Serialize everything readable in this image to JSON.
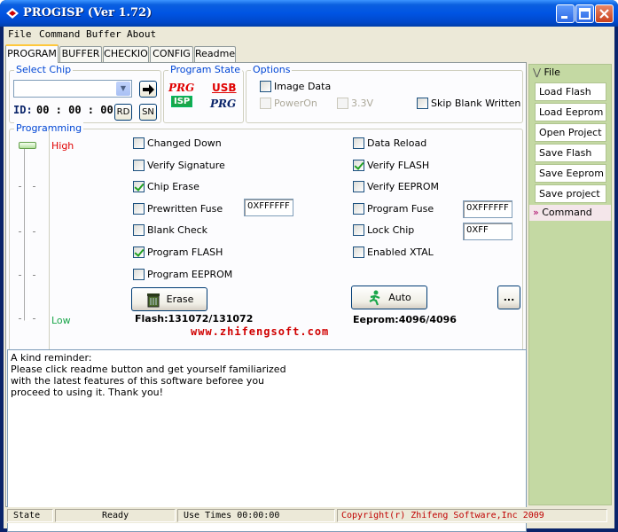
{
  "window": {
    "title": "PROGISP (Ver 1.72)"
  },
  "menu": [
    "File",
    "Command",
    "Buffer",
    "About"
  ],
  "tabs": [
    "PROGRAM",
    "BUFFER",
    "CHECKIO",
    "CONFIG",
    "Readme"
  ],
  "select_chip": {
    "label": "Select Chip",
    "value": "",
    "id_label": "ID:",
    "id_value": "00 : 00 : 00",
    "rd_label": "RD",
    "sn_label": "SN"
  },
  "program_state": {
    "label": "Program State",
    "logo1_top": "PRG",
    "logo1_bottom": "ISP",
    "logo2_top": "USB",
    "logo2_bottom": "PRG"
  },
  "options": {
    "label": "Options",
    "image_data": "Image Data",
    "power_on": "PowerOn",
    "v33": "3.3V",
    "skip_blank": "Skip Blank Written"
  },
  "programming": {
    "label": "Programming",
    "high": "High",
    "low": "Low",
    "left_options": [
      {
        "label": "Changed Down",
        "checked": false
      },
      {
        "label": "Verify Signature",
        "checked": false
      },
      {
        "label": "Chip Erase",
        "checked": true
      },
      {
        "label": "Prewritten Fuse",
        "checked": false
      },
      {
        "label": "Blank Check",
        "checked": false
      },
      {
        "label": "Program FLASH",
        "checked": true
      },
      {
        "label": "Program EEPROM",
        "checked": false
      }
    ],
    "right_options": [
      {
        "label": "Data Reload",
        "checked": false
      },
      {
        "label": "Verify FLASH",
        "checked": true
      },
      {
        "label": "Verify EEPROM",
        "checked": false
      },
      {
        "label": "Program Fuse",
        "checked": false
      },
      {
        "label": "Lock Chip",
        "checked": false
      },
      {
        "label": "Enabled XTAL",
        "checked": false
      }
    ],
    "prewritten_fuse_value": "0XFFFFFF",
    "program_fuse_value": "0XFFFFFF",
    "lock_chip_value": "0XFF",
    "erase_label": "Erase",
    "auto_label": "Auto",
    "more_label": "...",
    "flash_info": "Flash:131072/131072",
    "eeprom_info": "Eeprom:4096/4096",
    "website": "www.zhifengsoft.com"
  },
  "reminder": "A kind reminder:\nPlease click readme button and get yourself familiarized\nwith the latest features of this software beforee you\nproceed to using it. Thank you!",
  "sidebar": {
    "file_header": "File",
    "buttons": [
      "Load Flash",
      "Load Eeprom",
      "Open Project",
      "Save Flash",
      "Save Eeprom",
      "Save project"
    ],
    "command_header": "Command"
  },
  "status": {
    "state_label": "State",
    "state_value": "Ready",
    "use_times": "Use Times 00:00:00",
    "copyright": "Copyright(r) Zhifeng Software,Inc 2009"
  },
  "colors": {
    "accent_red": "#e00000",
    "group_label_blue": "#0046d5",
    "copyright_red": "#c00000"
  }
}
